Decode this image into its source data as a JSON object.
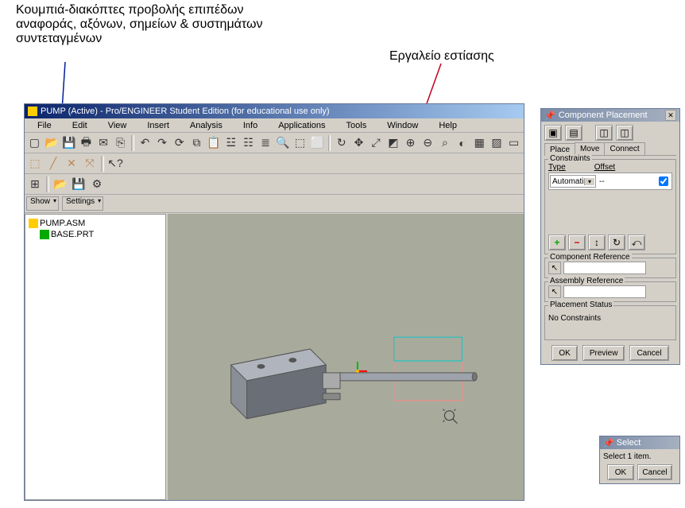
{
  "annotations": {
    "left": "Κουμπιά-διακόπτες προβολής επιπέδων αναφοράς, αξόνων, σημείων & συστημάτων συντεταγμένων",
    "right": "Εργαλείο εστίασης"
  },
  "window": {
    "title": "PUMP (Active) - Pro/ENGINEER Student Edition (for educational use only)"
  },
  "menu": {
    "file": "File",
    "edit": "Edit",
    "view": "View",
    "insert": "Insert",
    "analysis": "Analysis",
    "info": "Info",
    "applications": "Applications",
    "tools": "Tools",
    "window": "Window",
    "help": "Help"
  },
  "left_controls": {
    "show": "Show",
    "settings": "Settings"
  },
  "tree": {
    "root": "PUMP.ASM",
    "child1": "BASE.PRT"
  },
  "placement": {
    "title": "Component Placement",
    "tabs": {
      "place": "Place",
      "move": "Move",
      "connect": "Connect"
    },
    "constraints_legend": "Constraints",
    "type_header": "Type",
    "offset_header": "Offset",
    "type_value": "Automatic",
    "offset_value": "--",
    "comp_ref_legend": "Component Reference",
    "asm_ref_legend": "Assembly Reference",
    "status_legend": "Placement Status",
    "status_text": "No Constraints",
    "ok": "OK",
    "preview": "Preview",
    "cancel": "Cancel"
  },
  "select": {
    "title": "Select",
    "prompt": "Select 1 item.",
    "ok": "OK",
    "cancel": "Cancel"
  }
}
